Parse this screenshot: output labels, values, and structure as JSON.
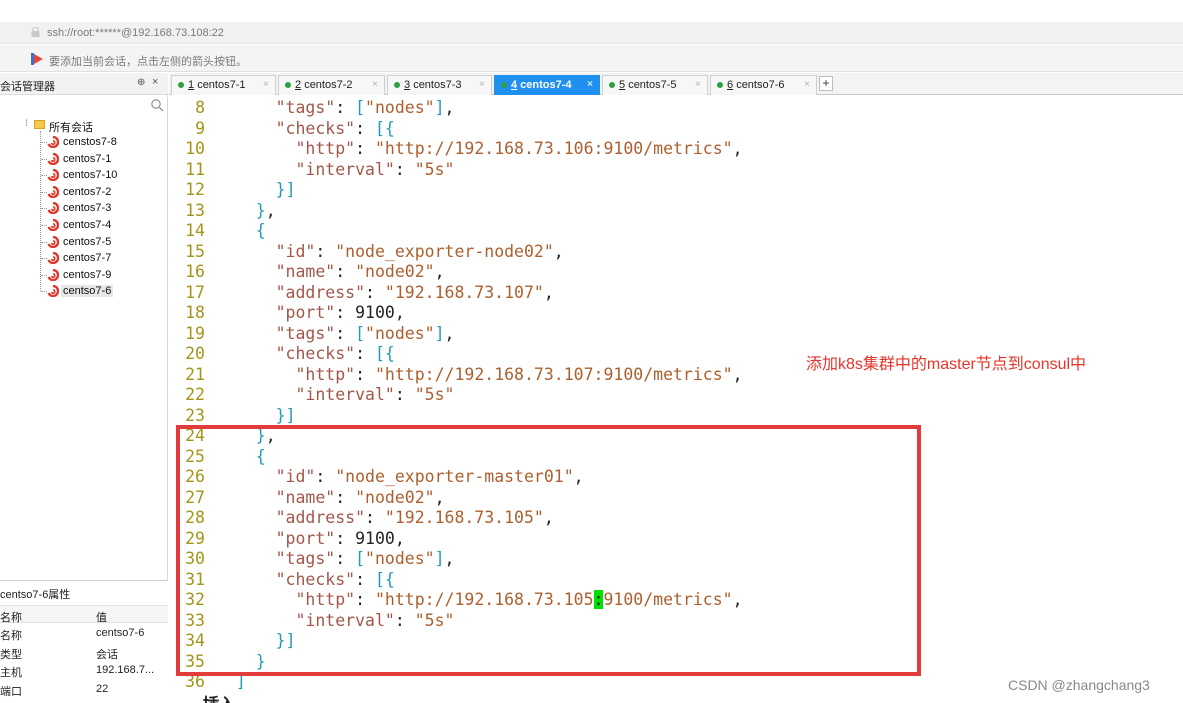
{
  "window": {
    "address": "ssh://root:******@192.168.73.108:22",
    "hint": "要添加当前会话，点击左侧的箭头按钮。"
  },
  "session_manager": {
    "title": "会话管理器",
    "pin_label": "⊕",
    "close_label": "×",
    "root_label": "所有会话",
    "sessions": [
      {
        "label": "censtos7-8"
      },
      {
        "label": "centos7-1"
      },
      {
        "label": "centos7-10"
      },
      {
        "label": "centos7-2"
      },
      {
        "label": "centos7-3"
      },
      {
        "label": "centos7-4"
      },
      {
        "label": "centos7-5"
      },
      {
        "label": "centos7-7"
      },
      {
        "label": "centos7-9"
      },
      {
        "label": "centso7-6"
      }
    ],
    "selected_session": "centso7-6"
  },
  "properties": {
    "title": "centso7-6属性",
    "header_name": "名称",
    "header_value": "值",
    "rows": [
      {
        "key": "名称",
        "value": "centso7-6"
      },
      {
        "key": "类型",
        "value": "会话"
      },
      {
        "key": "主机",
        "value": "192.168.7..."
      },
      {
        "key": "端口",
        "value": "22"
      }
    ]
  },
  "tabs": [
    {
      "num": "1",
      "label": "centos7-1",
      "active": false
    },
    {
      "num": "2",
      "label": "centos7-2",
      "active": false
    },
    {
      "num": "3",
      "label": "centos7-3",
      "active": false
    },
    {
      "num": "4",
      "label": "centos7-4",
      "active": true
    },
    {
      "num": "5",
      "label": "centos7-5",
      "active": false
    },
    {
      "num": "6",
      "label": "centso7-6",
      "active": false
    }
  ],
  "add_tab_label": "+",
  "tab_close_label": "×",
  "editor": {
    "lines": [
      {
        "n": "8",
        "text": "      \"tags\": [\"nodes\"],"
      },
      {
        "n": "9",
        "text": "      \"checks\": [{"
      },
      {
        "n": "10",
        "text": "        \"http\": \"http://192.168.73.106:9100/metrics\","
      },
      {
        "n": "11",
        "text": "        \"interval\": \"5s\""
      },
      {
        "n": "12",
        "text": "      }]"
      },
      {
        "n": "13",
        "text": "    },"
      },
      {
        "n": "14",
        "text": "    {"
      },
      {
        "n": "15",
        "text": "      \"id\": \"node_exporter-node02\","
      },
      {
        "n": "16",
        "text": "      \"name\": \"node02\","
      },
      {
        "n": "17",
        "text": "      \"address\": \"192.168.73.107\","
      },
      {
        "n": "18",
        "text": "      \"port\": 9100,"
      },
      {
        "n": "19",
        "text": "      \"tags\": [\"nodes\"],"
      },
      {
        "n": "20",
        "text": "      \"checks\": [{"
      },
      {
        "n": "21",
        "text": "        \"http\": \"http://192.168.73.107:9100/metrics\","
      },
      {
        "n": "22",
        "text": "        \"interval\": \"5s\""
      },
      {
        "n": "23",
        "text": "      }]"
      },
      {
        "n": "24",
        "text": "    },"
      },
      {
        "n": "25",
        "text": "    {"
      },
      {
        "n": "26",
        "text": "      \"id\": \"node_exporter-master01\","
      },
      {
        "n": "27",
        "text": "      \"name\": \"node02\","
      },
      {
        "n": "28",
        "text": "      \"address\": \"192.168.73.105\","
      },
      {
        "n": "29",
        "text": "      \"port\": 9100,"
      },
      {
        "n": "30",
        "text": "      \"tags\": [\"nodes\"],"
      },
      {
        "n": "31",
        "text": "      \"checks\": [{"
      },
      {
        "n": "32",
        "text": "        \"http\": \"http://192.168.73.105:9100/metrics\","
      },
      {
        "n": "33",
        "text": "        \"interval\": \"5s\""
      },
      {
        "n": "34",
        "text": "      }]"
      },
      {
        "n": "35",
        "text": "    }"
      },
      {
        "n": "36",
        "text": "  ]"
      }
    ],
    "mode": "-- 插入 --"
  },
  "annotation": "添加k8s集群中的master节点到consul中",
  "watermark": "CSDN @zhangchang3",
  "colors": {
    "active_tab": "#1f8ff0",
    "highlight_border": "#e33b3b",
    "annotation": "#e8342a",
    "cursor": "#00e000"
  }
}
